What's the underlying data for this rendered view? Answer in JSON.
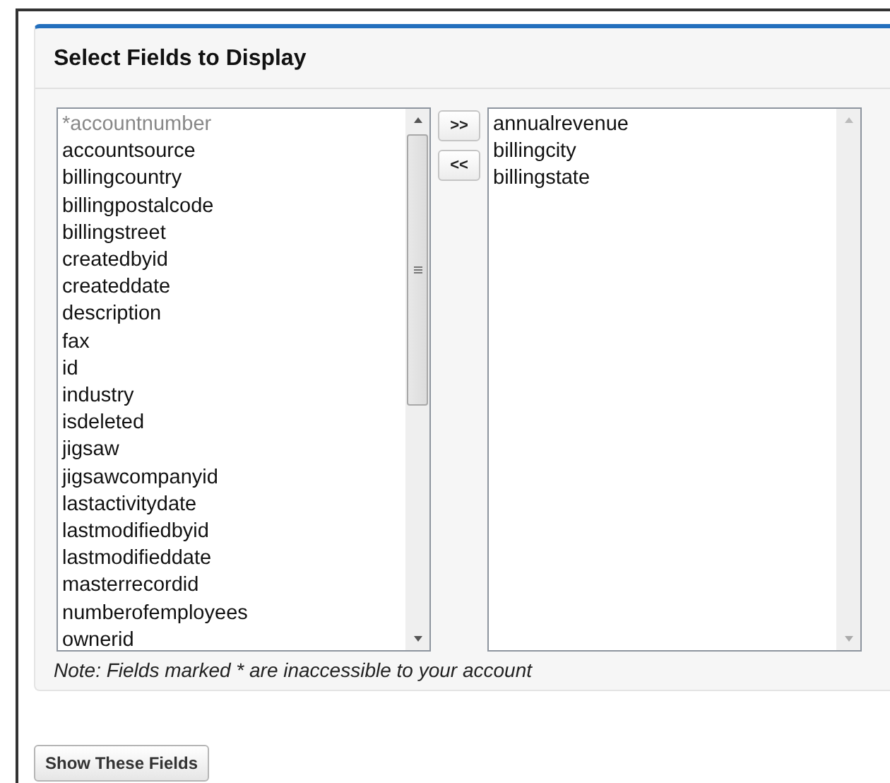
{
  "panel": {
    "title": "Select Fields to Display"
  },
  "available_fields": [
    {
      "label": "*accountnumber",
      "disabled": true
    },
    {
      "label": "accountsource",
      "disabled": false
    },
    {
      "label": "billingcountry",
      "disabled": false
    },
    {
      "label": "billingpostalcode",
      "disabled": false
    },
    {
      "label": "billingstreet",
      "disabled": false
    },
    {
      "label": "createdbyid",
      "disabled": false
    },
    {
      "label": "createddate",
      "disabled": false
    },
    {
      "label": "description",
      "disabled": false
    },
    {
      "label": "fax",
      "disabled": false
    },
    {
      "label": "id",
      "disabled": false
    },
    {
      "label": "industry",
      "disabled": false
    },
    {
      "label": "isdeleted",
      "disabled": false
    },
    {
      "label": "jigsaw",
      "disabled": false
    },
    {
      "label": "jigsawcompanyid",
      "disabled": false
    },
    {
      "label": "lastactivitydate",
      "disabled": false
    },
    {
      "label": "lastmodifiedbyid",
      "disabled": false
    },
    {
      "label": "lastmodifieddate",
      "disabled": false
    },
    {
      "label": "masterrecordid",
      "disabled": false
    },
    {
      "label": "numberofemployees",
      "disabled": false
    },
    {
      "label": "ownerid",
      "disabled": false
    }
  ],
  "move_buttons": [
    ">>",
    "<<"
  ],
  "selected_fields": [
    {
      "label": "annualrevenue",
      "disabled": false
    },
    {
      "label": "billingcity",
      "disabled": false
    },
    {
      "label": "billingstate",
      "disabled": false
    }
  ],
  "note": "Note: Fields marked * are inaccessible to your account",
  "submit_button": "Show These Fields"
}
